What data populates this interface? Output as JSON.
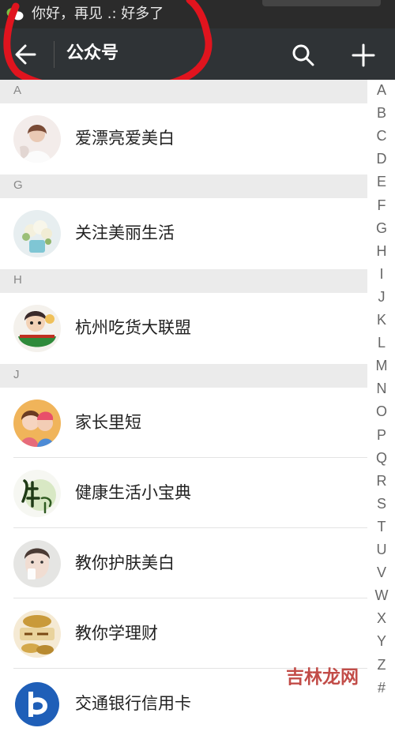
{
  "status_bar": {
    "notification_icon": "wechat-icon",
    "notification_text": "你好，再见 .: 好多了"
  },
  "action_bar": {
    "back_icon": "arrow-left-icon",
    "title": "公众号",
    "search_icon": "search-icon",
    "add_icon": "plus-icon"
  },
  "sections": [
    {
      "letter": "A",
      "items": [
        {
          "name": "爱漂亮爱美白",
          "avatar": "avatar-woman-white"
        }
      ]
    },
    {
      "letter": "G",
      "items": [
        {
          "name": "关注美丽生活",
          "avatar": "avatar-flowers"
        }
      ]
    },
    {
      "letter": "H",
      "items": [
        {
          "name": "杭州吃货大联盟",
          "avatar": "avatar-cartoon-food"
        }
      ]
    },
    {
      "letter": "J",
      "items": [
        {
          "name": "家长里短",
          "avatar": "avatar-couple"
        },
        {
          "name": "健康生活小宝典",
          "avatar": "avatar-calligraphy"
        },
        {
          "name": "教你护肤美白",
          "avatar": "avatar-skincare"
        },
        {
          "name": "教你学理财",
          "avatar": "avatar-coins"
        },
        {
          "name": "交通银行信用卡",
          "avatar": "avatar-bank"
        }
      ]
    }
  ],
  "index_letters": [
    "A",
    "B",
    "C",
    "D",
    "E",
    "F",
    "G",
    "H",
    "I",
    "J",
    "K",
    "L",
    "M",
    "N",
    "O",
    "P",
    "Q",
    "R",
    "S",
    "T",
    "U",
    "V",
    "W",
    "X",
    "Y",
    "Z",
    "#"
  ],
  "watermark": "吉林龙网",
  "colors": {
    "action_bar": "#2f3336",
    "status_bar": "#2b2b2b",
    "section_header": "#ebebeb",
    "annotation": "#e0141e"
  }
}
